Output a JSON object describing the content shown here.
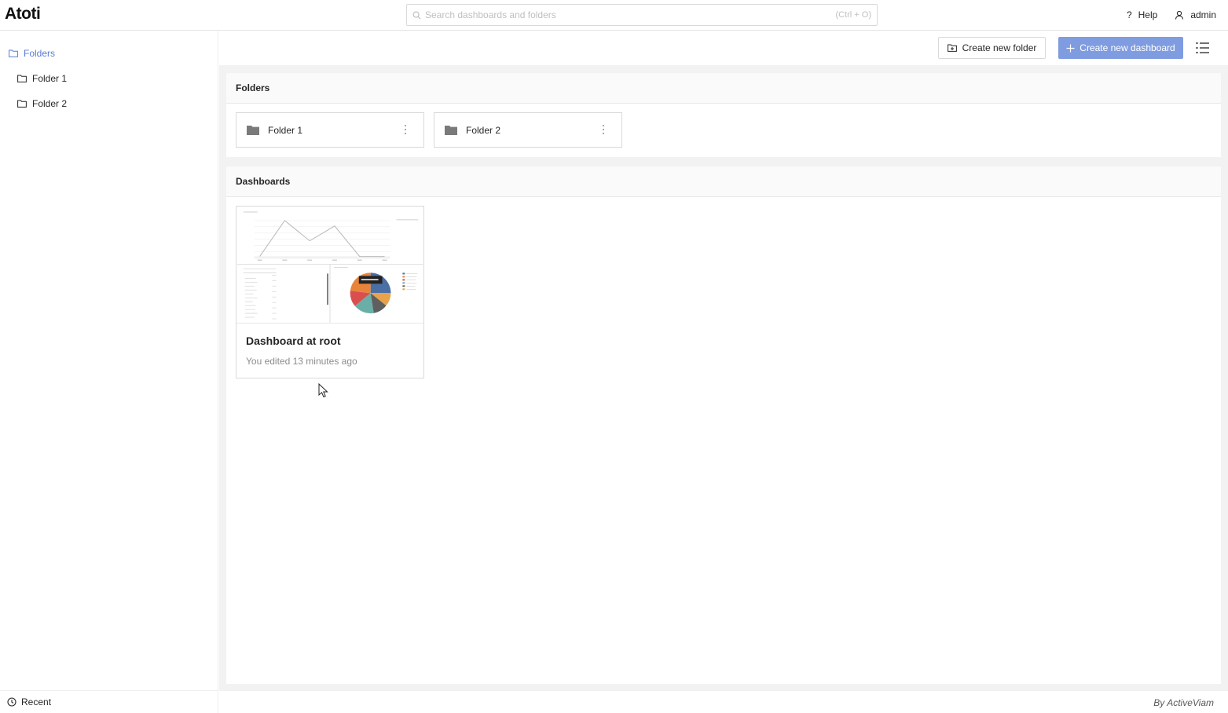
{
  "app": {
    "logo": "Atoti"
  },
  "search": {
    "placeholder": "Search dashboards and folders",
    "shortcut": "(Ctrl + O)"
  },
  "top_actions": {
    "help": "Help",
    "user": "admin"
  },
  "sidebar": {
    "root": "Folders",
    "items": [
      {
        "label": "Folder 1"
      },
      {
        "label": "Folder 2"
      }
    ],
    "recent": "Recent"
  },
  "toolbar": {
    "create_folder": "Create new folder",
    "create_dashboard": "Create new dashboard"
  },
  "folders_section": {
    "title": "Folders",
    "cards": [
      {
        "label": "Folder 1"
      },
      {
        "label": "Folder 2"
      }
    ]
  },
  "dashboards_section": {
    "title": "Dashboards",
    "cards": [
      {
        "title": "Dashboard at root",
        "subtitle": "You edited 13 minutes ago"
      }
    ]
  },
  "footer": {
    "credit": "By ActiveViam"
  },
  "colors": {
    "accent": "#7f9ce0",
    "link": "#5b7bd5"
  }
}
